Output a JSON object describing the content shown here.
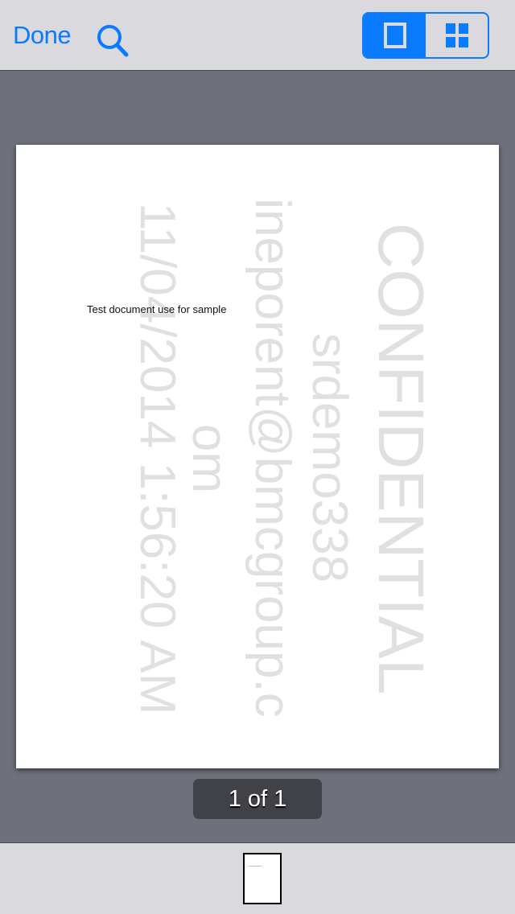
{
  "toolbar": {
    "done_label": "Done",
    "search_icon": "search-icon",
    "view_modes": [
      {
        "name": "single-page",
        "icon": "single-page-icon",
        "active": true
      },
      {
        "name": "grid",
        "icon": "grid-icon",
        "active": false
      }
    ],
    "accent_color": "#0a7aff"
  },
  "document": {
    "body_text": "Test document use for sample",
    "watermark": {
      "lines": [
        "CONFIDENTIAL",
        "srdemo338",
        "ineporent@bmcgroup.c",
        "om",
        "11/04/2014 1:56:20 AM"
      ],
      "color": "#e0e0e0"
    }
  },
  "pager": {
    "label": "1 of 1",
    "current_page": 1,
    "total_pages": 1
  },
  "thumbnails": [
    {
      "page": 1,
      "selected": true
    }
  ]
}
